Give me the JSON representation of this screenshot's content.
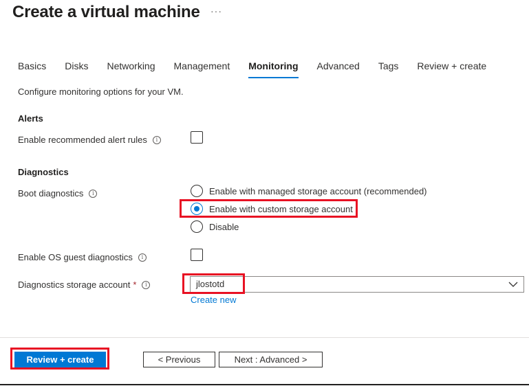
{
  "header": {
    "title": "Create a virtual machine",
    "more": "···"
  },
  "tabs": [
    {
      "label": "Basics"
    },
    {
      "label": "Disks"
    },
    {
      "label": "Networking"
    },
    {
      "label": "Management"
    },
    {
      "label": "Monitoring",
      "active": true
    },
    {
      "label": "Advanced"
    },
    {
      "label": "Tags"
    },
    {
      "label": "Review + create"
    }
  ],
  "intro": "Configure monitoring options for your VM.",
  "alerts": {
    "heading": "Alerts",
    "recommended_label": "Enable recommended alert rules",
    "recommended_checked": false
  },
  "diagnostics": {
    "heading": "Diagnostics",
    "boot_label": "Boot diagnostics",
    "boot_options": [
      "Enable with managed storage account (recommended)",
      "Enable with custom storage account",
      "Disable"
    ],
    "boot_selected": "Enable with custom storage account",
    "os_guest_label": "Enable OS guest diagnostics",
    "os_guest_checked": false,
    "storage_label": "Diagnostics storage account",
    "storage_required": "*",
    "storage_value": "jlostotd",
    "create_new": "Create new"
  },
  "info_glyph": "i",
  "footer": {
    "review_create": "Review + create",
    "previous": "< Previous",
    "next": "Next : Advanced >"
  },
  "colors": {
    "accent": "#0078d4",
    "highlight": "#e81123"
  }
}
